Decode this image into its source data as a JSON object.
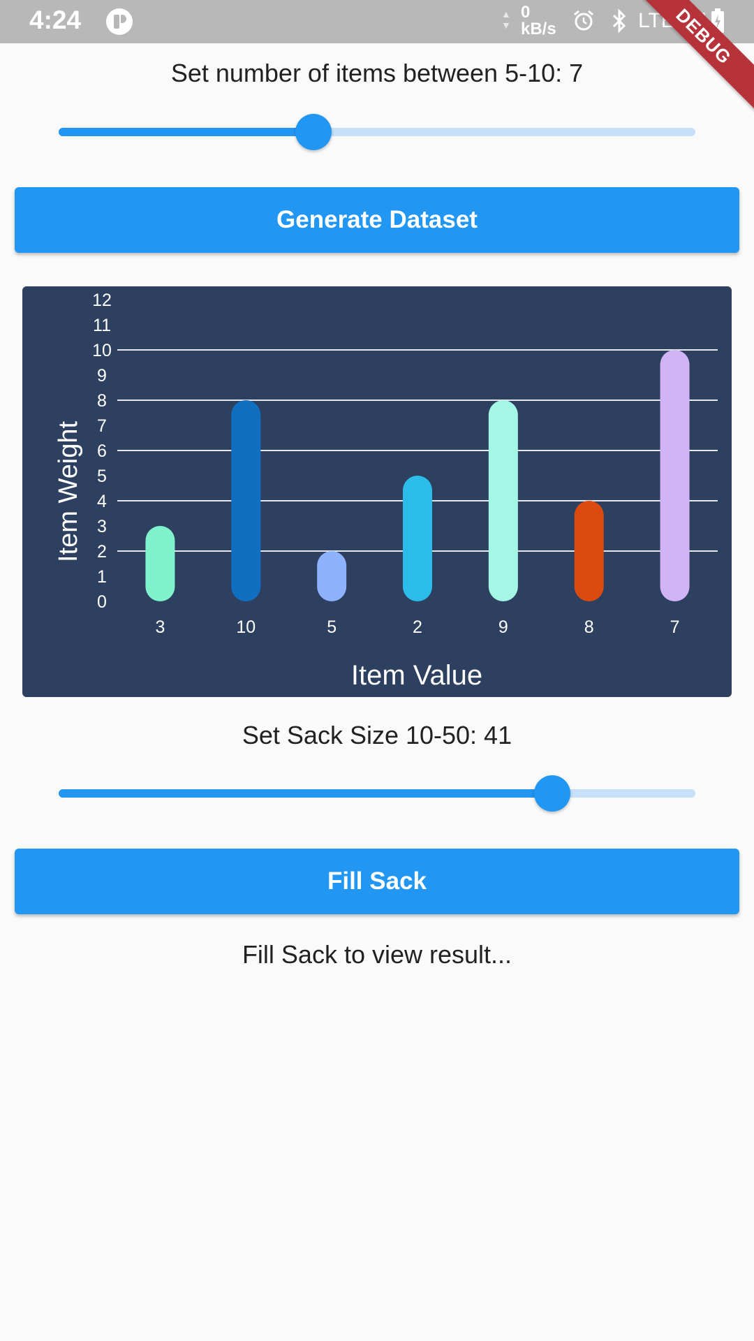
{
  "status_bar": {
    "time": "4:24",
    "net_speed_value": "0",
    "net_speed_unit": "kB/s",
    "network": "LTE",
    "icons": [
      "app-icon",
      "data-arrows-icon",
      "alarm-icon",
      "bluetooth-icon",
      "signal-icon",
      "battery-icon"
    ]
  },
  "debug_banner": "DEBUG",
  "items_slider": {
    "label": "Set number of items between 5-10: 7",
    "value": 7,
    "min": 5,
    "max": 10
  },
  "generate_button": {
    "label": "Generate Dataset"
  },
  "chart_data": {
    "type": "bar",
    "categories": [
      "3",
      "10",
      "5",
      "2",
      "9",
      "8",
      "7"
    ],
    "values": [
      3,
      8,
      2,
      5,
      8,
      4,
      10
    ],
    "colors": [
      "#7ff3cb",
      "#116fc2",
      "#8fb2ff",
      "#2bbcea",
      "#a4f6e5",
      "#db4a0f",
      "#d0b4f5"
    ],
    "xlabel": "Item Value",
    "ylabel": "Item Weight",
    "ylim": [
      0,
      12
    ],
    "y_ticks": [
      "0",
      "1",
      "2",
      "3",
      "4",
      "5",
      "6",
      "7",
      "8",
      "9",
      "10",
      "11",
      "12"
    ],
    "gridlines_at": [
      2,
      4,
      6,
      8,
      10
    ],
    "background": "#2e4060"
  },
  "sack_slider": {
    "label": "Set Sack Size 10-50: 41",
    "value": 41,
    "min": 10,
    "max": 50
  },
  "fill_button": {
    "label": "Fill Sack"
  },
  "result_text": "Fill Sack to view result...",
  "colors": {
    "accent": "#2196f3",
    "status_bar": "#b8b8b8",
    "banner": "#b7333b",
    "background": "#fafafa"
  }
}
